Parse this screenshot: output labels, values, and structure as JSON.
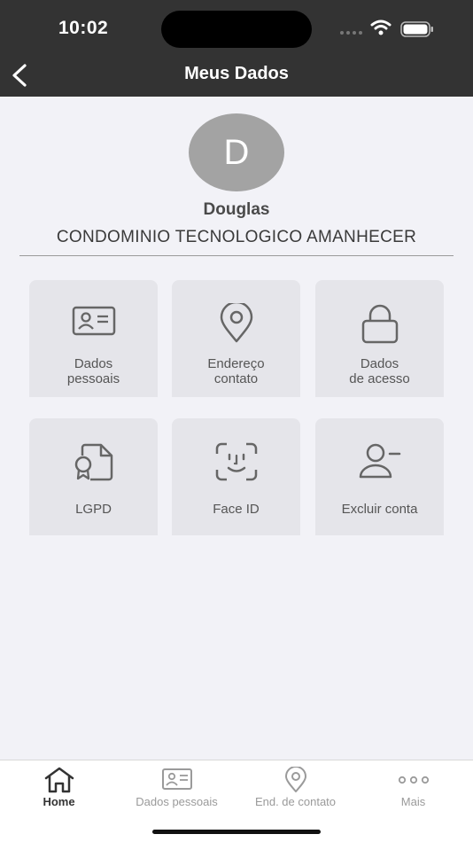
{
  "status_bar": {
    "time": "10:02"
  },
  "header": {
    "title": "Meus Dados",
    "back_icon": "chevron-left-icon"
  },
  "profile": {
    "avatar_initial": "D",
    "name": "Douglas",
    "condominium": "CONDOMINIO TECNOLOGICO AMANHECER"
  },
  "tiles": [
    {
      "label": "Dados\npessoais",
      "icon": "id-card-icon"
    },
    {
      "label": "Endereço\ncontato",
      "icon": "location-pin-icon"
    },
    {
      "label": "Dados\nde acesso",
      "icon": "lock-icon"
    },
    {
      "label": "LGPD",
      "icon": "certificate-document-icon"
    },
    {
      "label": "Face ID",
      "icon": "face-id-icon"
    },
    {
      "label": "Excluir conta",
      "icon": "remove-user-icon"
    }
  ],
  "tab_bar": {
    "items": [
      {
        "label": "Home",
        "icon": "home-icon",
        "active": true
      },
      {
        "label": "Dados pessoais",
        "icon": "id-card-icon",
        "active": false
      },
      {
        "label": "End. de contato",
        "icon": "location-pin-icon",
        "active": false
      },
      {
        "label": "Mais",
        "icon": "more-dots-icon",
        "active": false
      }
    ]
  },
  "colors": {
    "header_bg": "#333333",
    "page_bg": "#f2f2f7",
    "tile_bg": "#e5e5ea",
    "avatar_bg": "#a3a3a3"
  }
}
